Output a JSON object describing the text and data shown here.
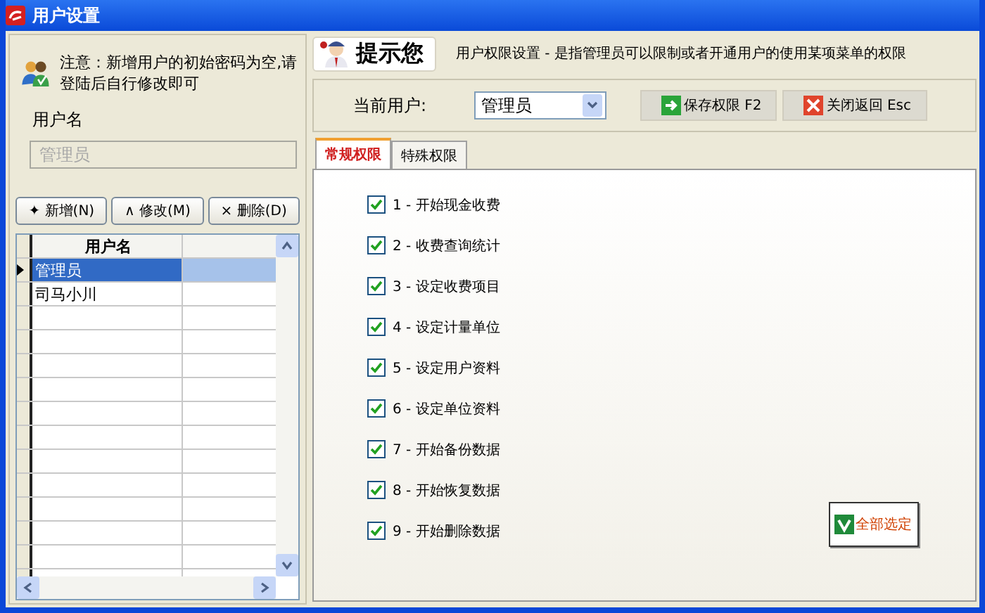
{
  "window": {
    "title": "用户设置"
  },
  "notice": "注意：新增用户的初始密码为空,请登陆后自行修改即可",
  "username_field": {
    "label": "用户名",
    "value": "管理员",
    "disabled": true
  },
  "user_buttons": [
    {
      "label": "✦ 新增(N)"
    },
    {
      "label": "∧ 修改(M)"
    },
    {
      "label": "× 删除(D)"
    }
  ],
  "user_table": {
    "columns": [
      "用户名",
      ""
    ],
    "rows": [
      {
        "cells": [
          "管理员",
          ""
        ],
        "selected": true
      },
      {
        "cells": [
          "司马小川",
          ""
        ],
        "selected": false
      }
    ]
  },
  "hint": {
    "title": "提示您",
    "text": "用户权限设置 - 是指管理员可以限制或者开通用户的使用某项菜单的权限"
  },
  "current_user": {
    "label": "当前用户:",
    "value": "管理员"
  },
  "actions": [
    {
      "label": "保存权限 F2",
      "kind": "save"
    },
    {
      "label": "关闭返回 Esc",
      "kind": "close"
    }
  ],
  "tabs": [
    {
      "label": "常规权限",
      "selected": true
    },
    {
      "label": "特殊权限",
      "selected": false
    }
  ],
  "permissions": [
    {
      "label": "1 - 开始现金收费",
      "checked": true
    },
    {
      "label": "2 - 收费查询统计",
      "checked": true
    },
    {
      "label": "3 - 设定收费项目",
      "checked": true
    },
    {
      "label": "4 - 设定计量单位",
      "checked": true
    },
    {
      "label": "5 - 设定用户资料",
      "checked": true
    },
    {
      "label": "6 - 设定单位资料",
      "checked": true
    },
    {
      "label": "7 - 开始备份数据",
      "checked": true
    },
    {
      "label": "8 - 开始恢复数据",
      "checked": true
    },
    {
      "label": "9 - 开始删除数据",
      "checked": true
    }
  ],
  "select_all_button": {
    "label": "全部选定"
  }
}
